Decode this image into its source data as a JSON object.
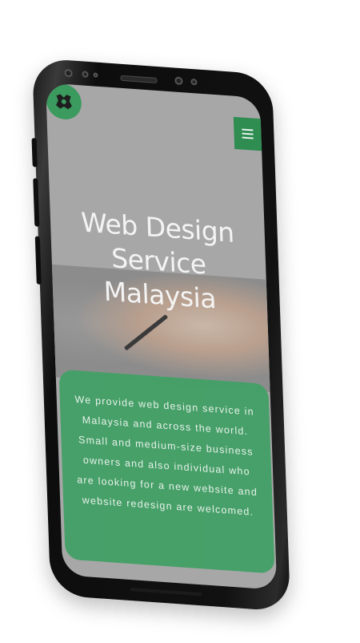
{
  "hero": {
    "title_line1": "Web Design",
    "title_line2": "Service",
    "title_line3": "Malaysia"
  },
  "intro": {
    "text": "We provide web design service in Malaysia and across the world. Small and medium-size business owners and also individual who are looking for a new website and website redesign are welcomed."
  },
  "header": {
    "menu_icon": "hamburger-menu-icon",
    "logo_icon": "logo-icon"
  },
  "colors": {
    "brand_green": "#3b9a5e",
    "card_green": "#43a066",
    "screen_overlay": "#a7a7a7"
  }
}
